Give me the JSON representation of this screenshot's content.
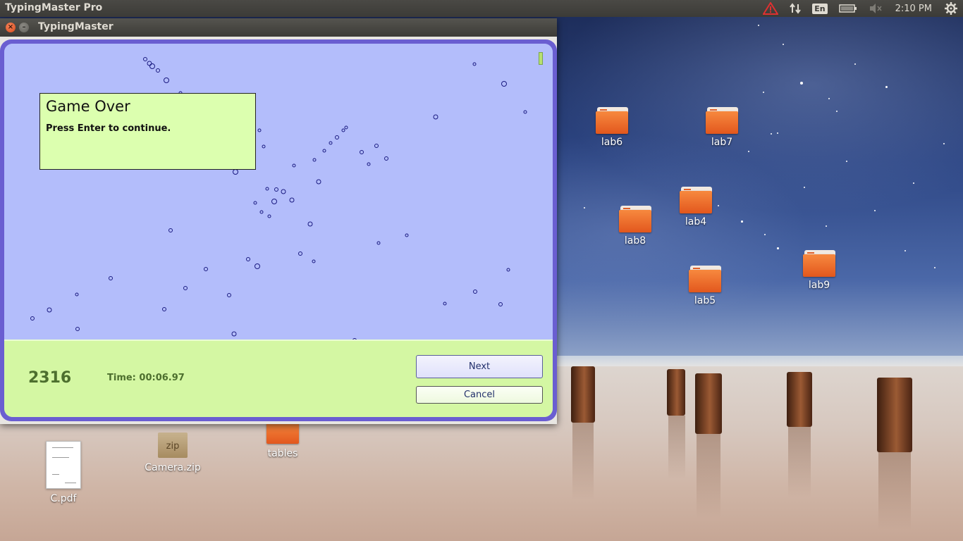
{
  "top_panel": {
    "app_name": "TypingMaster Pro",
    "language": "En",
    "clock": "2:10 PM",
    "icons": [
      "warning-icon",
      "network-transfer-icon",
      "keyboard-language-icon",
      "battery-icon",
      "volume-muted-icon",
      "settings-gear-icon"
    ]
  },
  "window": {
    "title": "TypingMaster",
    "dialog": {
      "title": "Game Over",
      "message": "Press Enter to continue."
    },
    "score": "2316",
    "time": "Time: 00:06.97",
    "next_label": "Next",
    "cancel_label": "Cancel"
  },
  "desktop": {
    "folders": [
      {
        "label": "lab6"
      },
      {
        "label": "lab7"
      },
      {
        "label": "lab4"
      },
      {
        "label": "lab8"
      },
      {
        "label": "lab9"
      },
      {
        "label": "lab5"
      }
    ],
    "files": [
      {
        "label": "C.pdf"
      },
      {
        "label": "Camera.zip",
        "icon_text": "zip"
      },
      {
        "label": "tables"
      }
    ]
  },
  "colors": {
    "playfield": "#b3bdfb",
    "frame": "#6a5ed1",
    "bottom_bar": "#d4f7a3",
    "dialog": "#dcffaf",
    "bubble_stroke": "#1a1a80"
  }
}
